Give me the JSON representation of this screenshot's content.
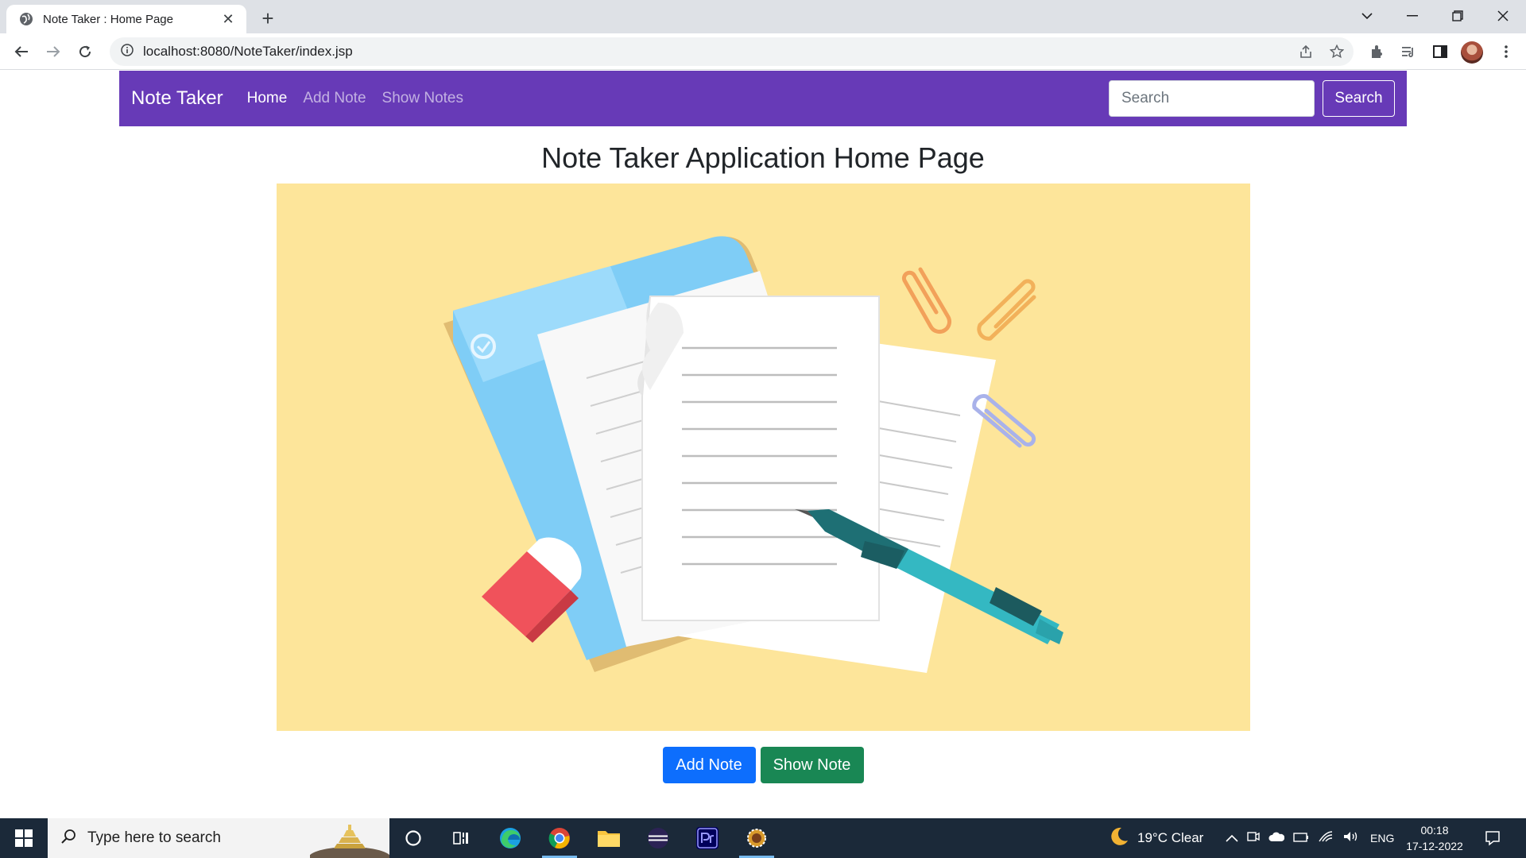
{
  "browser": {
    "tab_title": "Note Taker : Home Page",
    "url": "localhost:8080/NoteTaker/index.jsp"
  },
  "navbar": {
    "brand": "Note Taker",
    "links": [
      "Home",
      "Add Note",
      "Show Notes"
    ],
    "active_link": "Home",
    "search_placeholder": "Search",
    "search_button": "Search",
    "color": "#673ab7"
  },
  "main": {
    "heading": "Note Taker Application Home Page",
    "illustration": "notes-folder-pen-illustration",
    "buttons": {
      "add_note": "Add Note",
      "show_note": "Show Note"
    }
  },
  "taskbar": {
    "search_placeholder": "Type here to search",
    "weather": "19°C  Clear",
    "language": "ENG",
    "time": "00:18",
    "date": "17-12-2022"
  },
  "colors": {
    "primary": "#0d6efd",
    "success": "#198754",
    "hero_bg": "#fde59a"
  }
}
